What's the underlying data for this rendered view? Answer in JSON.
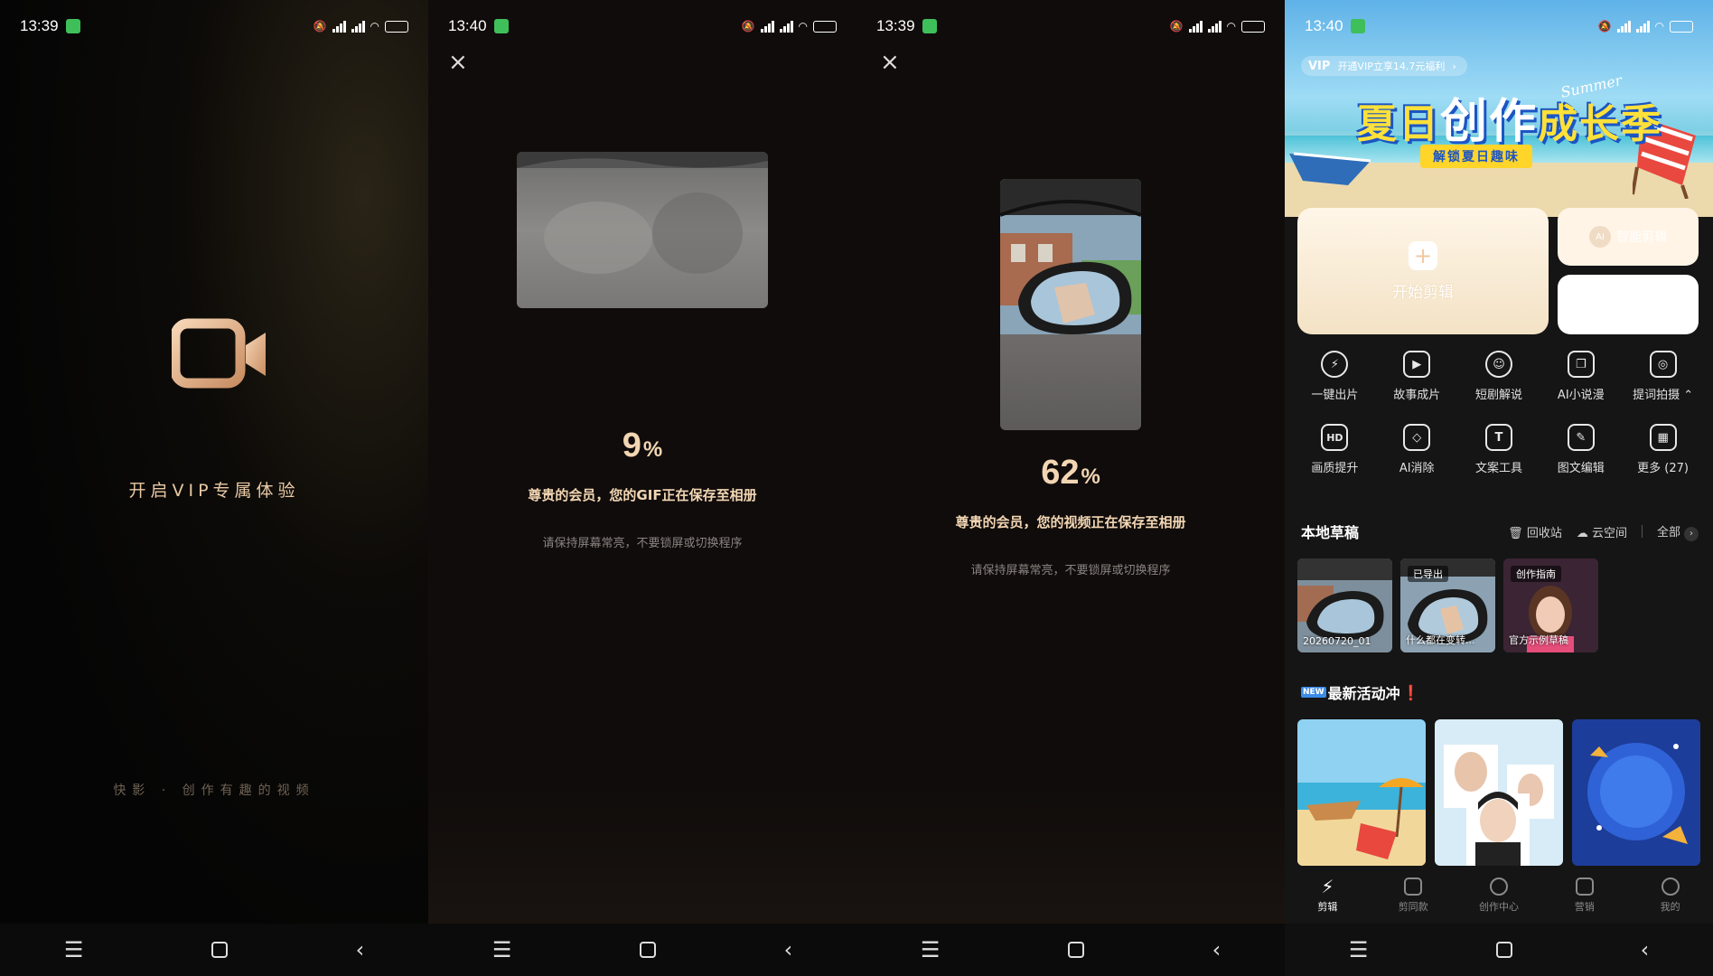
{
  "panel1": {
    "status": {
      "time": "13:39"
    },
    "title": "开启VIP专属体验",
    "slogan": "快影 · 创作有趣的视频"
  },
  "panel2": {
    "status": {
      "time": "13:40"
    },
    "close_icon": "×",
    "progress_value": "9",
    "progress_unit": "%",
    "message": "尊贵的会员，您的GIF正在保存至相册",
    "hint": "请保持屏幕常亮，不要锁屏或切换程序"
  },
  "panel3": {
    "status": {
      "time": "13:39"
    },
    "close_icon": "×",
    "progress_value": "62",
    "progress_unit": "%",
    "message": "尊贵的会员，您的视频正在保存至相册",
    "hint": "请保持屏幕常亮，不要锁屏或切换程序"
  },
  "panel4": {
    "status": {
      "time": "13:40"
    },
    "vip_chip": {
      "badge": "VIP",
      "text": "开通VIP立享14.7元福利"
    },
    "banner": {
      "title_pre": "夏日",
      "title_big": "创作",
      "title_post": "成长季",
      "subtitle": "解锁夏日趣味",
      "script": "Summer"
    },
    "start_edit": "开始剪辑",
    "ai_edit": "智能剪辑",
    "ai_tag": "AI",
    "tools": [
      {
        "label": "一键出片",
        "icon": "lightning-icon",
        "glyph": "⚡"
      },
      {
        "label": "故事成片",
        "icon": "story-ai-icon",
        "glyph": "▶"
      },
      {
        "label": "短剧解说",
        "icon": "drama-icon",
        "glyph": "☺"
      },
      {
        "label": "AI小说漫",
        "icon": "book-icon",
        "glyph": "❐"
      },
      {
        "label": "提词拍摄 ⌃",
        "icon": "camera-icon",
        "glyph": "◎"
      },
      {
        "label": "画质提升",
        "icon": "hd-icon",
        "glyph": "HD"
      },
      {
        "label": "AI消除",
        "icon": "eraser-icon",
        "glyph": "◇"
      },
      {
        "label": "文案工具",
        "icon": "text-tool-icon",
        "glyph": "T"
      },
      {
        "label": "图文编辑",
        "icon": "image-edit-icon",
        "glyph": "✎"
      },
      {
        "label": "更多 (27)",
        "icon": "grid-icon",
        "glyph": "▦"
      }
    ],
    "drafts_title": "本地草稿",
    "recycle": "回收站",
    "cloud": "云空间",
    "all": "全部",
    "drafts": [
      {
        "caption": "20260720_01",
        "tag": ""
      },
      {
        "caption": "什么都在变转...",
        "tag": "已导出"
      },
      {
        "caption": "官方示例草稿",
        "tag": "创作指南"
      }
    ],
    "news_badge": "NEW",
    "news_title": "最新活动冲",
    "news_excl": "❗",
    "tabs": [
      {
        "label": "剪辑",
        "active": true
      },
      {
        "label": "剪同款",
        "active": false
      },
      {
        "label": "创作中心",
        "active": false
      },
      {
        "label": "营销",
        "active": false
      },
      {
        "label": "我的",
        "active": false
      }
    ]
  },
  "nav": {
    "menu": "☰",
    "back": "‹"
  },
  "colors": {
    "gold": "#f2d6b3",
    "accent_green": "#3ed55a",
    "dark_bg": "#100c0b"
  }
}
